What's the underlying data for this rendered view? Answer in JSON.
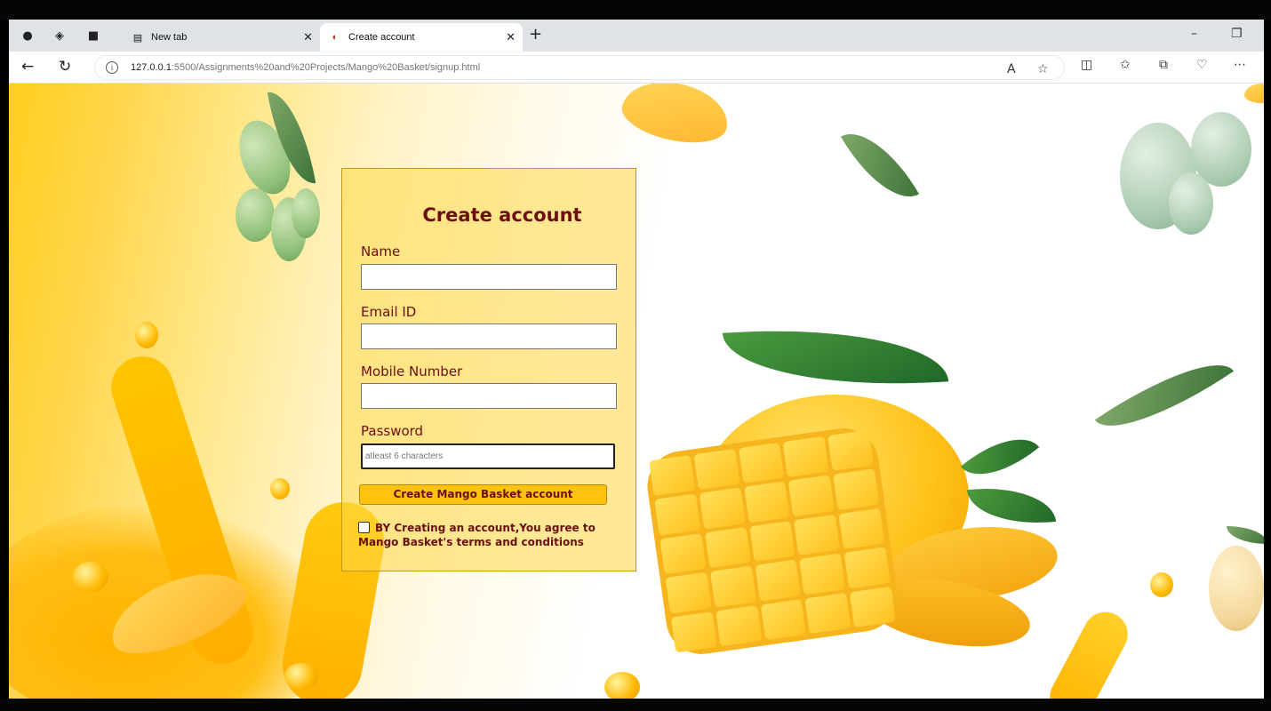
{
  "browser": {
    "tabs": [
      {
        "label": "New tab",
        "icon": "new-tab-page-icon",
        "active": false
      },
      {
        "label": "Create account",
        "icon": "mango-favicon",
        "active": true
      }
    ],
    "url": {
      "host": "127.0.0.1",
      "rest": ":5500/Assignments%20and%20Projects/Mango%20Basket/signup.html"
    }
  },
  "form": {
    "title": "Create account",
    "fields": {
      "name": {
        "label": "Name",
        "value": ""
      },
      "email": {
        "label": "Email ID",
        "value": ""
      },
      "mobile": {
        "label": "Mobile Number",
        "value": ""
      },
      "password": {
        "label": "Password",
        "placeholder": "atleast 6 characters"
      }
    },
    "submit_label": "Create Mango Basket account",
    "terms_text": "BY Creating an account,You agree to Mango Basket's terms and conditions",
    "terms_checked": false
  },
  "colors": {
    "label": "#6b0f12",
    "button": "#ffc210",
    "card": "#ffd746"
  }
}
